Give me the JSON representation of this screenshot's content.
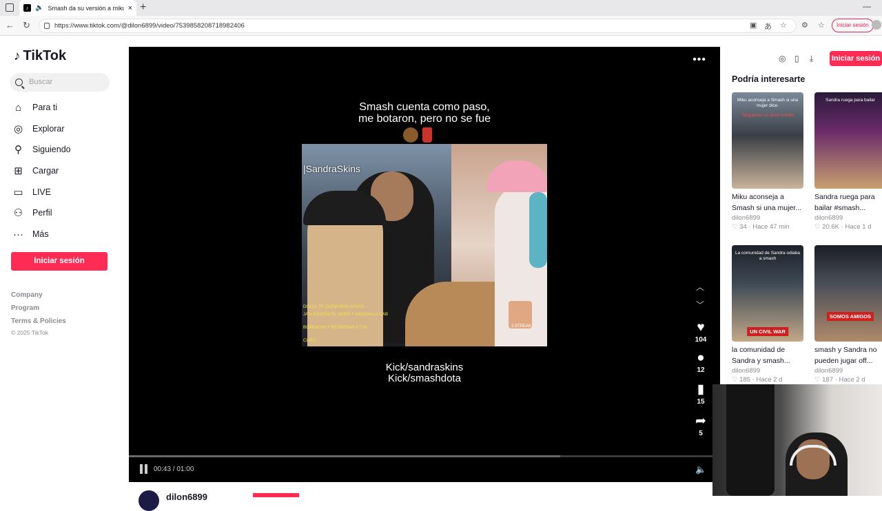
{
  "browser": {
    "tab_title": "Smash da su versión a miku",
    "new_tab": "+",
    "url": "https://www.tiktok.com/@dilon6899/video/7539858208718982406",
    "login_label": "Iniciar sesión"
  },
  "tiktok": {
    "logo_text": "TikTok",
    "search_placeholder": "Buscar",
    "nav": [
      "Para ti",
      "Explorar",
      "Siguiendo",
      "Cargar",
      "LIVE",
      "Perfil",
      "Más"
    ],
    "login_button": "Iniciar sesión",
    "footer_links": [
      "Company",
      "Program",
      "Terms & Policies"
    ],
    "copyright": "© 2025 TikTok"
  },
  "video": {
    "caption_line1": "Smash cuenta como paso,",
    "caption_line2": "me botaron, pero no se fue",
    "watermark": "|SandraSkins",
    "overlay_lines": [
      "DO222: TE QUEMARON CHATA",
      "JATA ENSEÑA EL VIDEO Y AGACHA LA CAB",
      "BORRACHA Y REGRESAR A TUS",
      "CLIPS!"
    ],
    "pip_label": "2.STREAK",
    "kick_line1": "Kick/sandraskins",
    "kick_line2": "Kick/smashdota",
    "likes": "104",
    "comments": "12",
    "saves": "15",
    "shares": "5",
    "time": "00:43 / 01:00",
    "progress": 0.73,
    "creator": "dilon6899"
  },
  "right": {
    "login_button": "Iniciar sesión",
    "section_title": "Podría interesarte",
    "cards": [
      {
        "thumb_text": "Miku aconseja a Smash si una mujer dice:",
        "thumb_sub": "Tengamos un amor bonito",
        "caption": "Miku aconseja a Smash si una mujer...",
        "author": "dilon6899",
        "likes": "34",
        "age": "Hace 47 min",
        "badge": ""
      },
      {
        "thumb_text": "Sandra ruega para bailar",
        "thumb_sub": "",
        "caption": "Sandra ruega para bailar #smash...",
        "author": "dilon6899",
        "likes": "20.6K",
        "age": "Hace 1 d",
        "badge": ""
      },
      {
        "thumb_text": "La comunidad de Sandra odiaba a smash",
        "thumb_sub": "",
        "caption": "la comunidad de Sandra y smash...",
        "author": "dilon6899",
        "likes": "185",
        "age": "Hace 2 d",
        "badge": "UN CIVIL WAR"
      },
      {
        "thumb_text": "",
        "thumb_sub": "",
        "caption": "smash y Sandra no pueden jugar off...",
        "author": "dilon6899",
        "likes": "187",
        "age": "Hace 2 d",
        "badge": "SOMOS AMIGOS"
      }
    ]
  },
  "colors": {
    "accent": "#fe2c55",
    "player_bg": "#000000"
  }
}
